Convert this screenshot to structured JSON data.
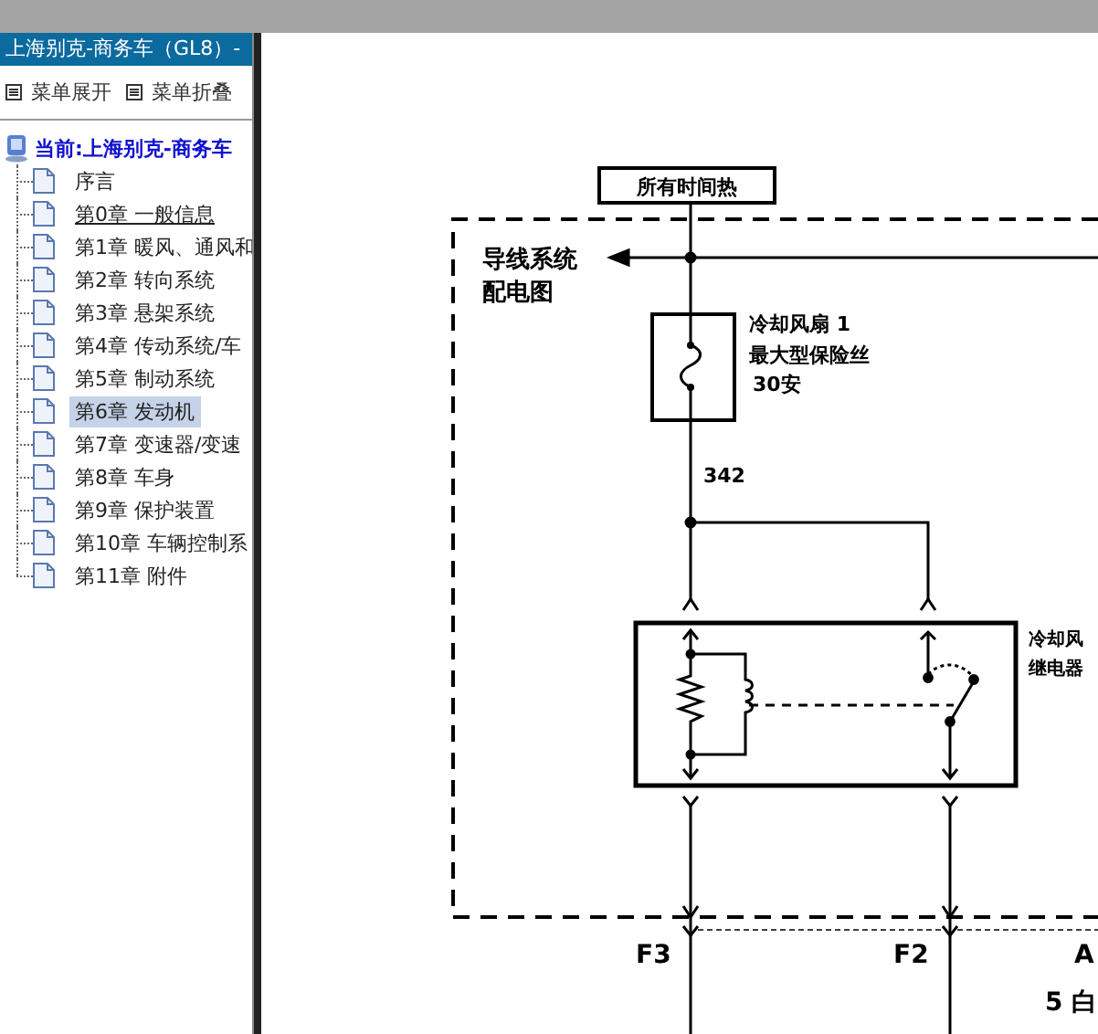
{
  "window": {
    "title": "上海别克-商务车（GL8）-"
  },
  "toolbar": [
    {
      "label": "菜单展开"
    },
    {
      "label": "菜单折叠"
    }
  ],
  "tree": {
    "root": "当前:上海别克-商务车",
    "children": [
      {
        "label": "序言",
        "selected": false,
        "hovered": false
      },
      {
        "label": "第0章 一般信息",
        "selected": false,
        "hovered": true
      },
      {
        "label": "第1章 暖风、通风和",
        "selected": false,
        "hovered": false
      },
      {
        "label": "第2章 转向系统",
        "selected": false,
        "hovered": false
      },
      {
        "label": "第3章 悬架系统",
        "selected": false,
        "hovered": false
      },
      {
        "label": "第4章 传动系统/车",
        "selected": false,
        "hovered": false
      },
      {
        "label": "第5章 制动系统",
        "selected": false,
        "hovered": false
      },
      {
        "label": "第6章 发动机",
        "selected": true,
        "hovered": false
      },
      {
        "label": "第7章 变速器/变速",
        "selected": false,
        "hovered": false
      },
      {
        "label": "第8章 车身",
        "selected": false,
        "hovered": false
      },
      {
        "label": "第9章 保护装置",
        "selected": false,
        "hovered": false
      },
      {
        "label": "第10章 车辆控制系",
        "selected": false,
        "hovered": false
      },
      {
        "label": "第11章 附件",
        "selected": false,
        "hovered": false
      }
    ]
  },
  "diagram": {
    "source": "所有时间热",
    "wiring_ref": [
      "导线系统",
      "配电图"
    ],
    "fuse_label": [
      "冷却风扇 1",
      "最大型保险丝",
      "30安"
    ],
    "wire_number": "342",
    "relay_label": [
      "冷却风",
      "继电器"
    ],
    "connectors": [
      "F3",
      "F2",
      "A"
    ],
    "wire_color": "5 白"
  }
}
